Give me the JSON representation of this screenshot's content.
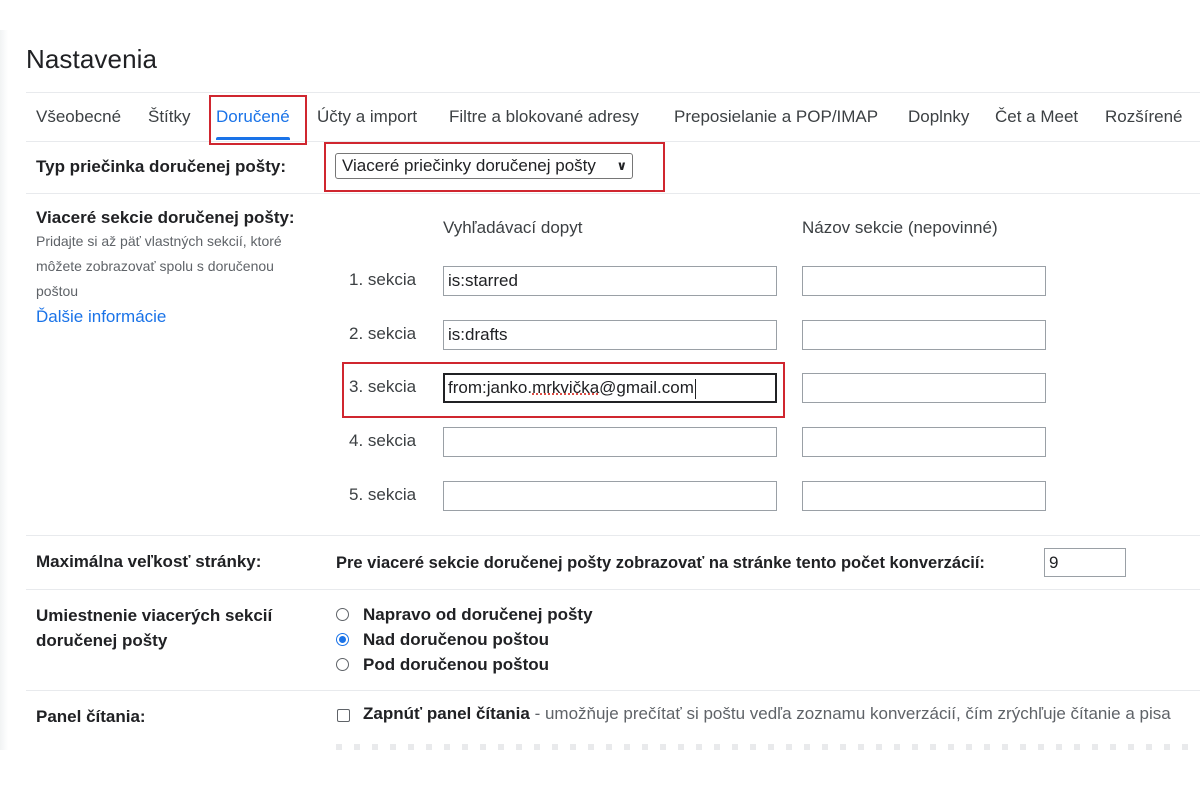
{
  "page": {
    "title": "Nastavenia"
  },
  "tabs": [
    {
      "label": "Všeobecné"
    },
    {
      "label": "Štítky"
    },
    {
      "label": "Doručené"
    },
    {
      "label": "Účty a import"
    },
    {
      "label": "Filtre a blokované adresy"
    },
    {
      "label": "Preposielanie a POP/IMAP"
    },
    {
      "label": "Doplnky"
    },
    {
      "label": "Čet a Meet"
    },
    {
      "label": "Rozšírené"
    }
  ],
  "active_tab": "Doručené",
  "inbox_type": {
    "label": "Typ priečinka doručenej pošty:",
    "selected": "Viaceré priečinky doručenej pošty"
  },
  "multiple_inboxes": {
    "label": "Viaceré sekcie doručenej pošty:",
    "help_lines": [
      "Pridajte si až päť vlastných sekcií, ktoré",
      "môžete zobrazovať spolu s doručenou",
      "poštou"
    ],
    "more_info_link": "Ďalšie informácie",
    "col_query": "Vyhľadávací dopyt",
    "col_name": "Názov sekcie (nepovinné)",
    "sections": [
      {
        "label": "1. sekcia",
        "query": "is:starred",
        "name": ""
      },
      {
        "label": "2. sekcia",
        "query": "is:drafts",
        "name": ""
      },
      {
        "label": "3. sekcia",
        "query_a": "from:janko.",
        "query_b": "mrkvička",
        "query_c": "@gmail.com",
        "name": ""
      },
      {
        "label": "4. sekcia",
        "query": "",
        "name": ""
      },
      {
        "label": "5. sekcia",
        "query": "",
        "name": ""
      }
    ]
  },
  "page_size": {
    "label": "Maximálna veľkosť stránky:",
    "text": "Pre viaceré sekcie doručenej pošty zobrazovať na stránke tento počet konverzácií:",
    "value": "9"
  },
  "placement": {
    "label_line1": "Umiestnenie viacerých sekcií",
    "label_line2": "doručenej pošty",
    "options": [
      {
        "label": "Napravo od doručenej pošty",
        "checked": false
      },
      {
        "label": "Nad doručenou poštou",
        "checked": true
      },
      {
        "label": "Pod doručenou poštou",
        "checked": false
      }
    ]
  },
  "reading_pane": {
    "label": "Panel čítania:",
    "checkbox_bold": "Zapnúť panel čítania",
    "checkbox_rest": " - umožňuje prečítať si poštu vedľa zoznamu konverzácií, čím zrýchľuje čítanie a pisa",
    "checked": false
  },
  "colors": {
    "accent": "#1a73e8",
    "highlight": "#d0262f"
  }
}
